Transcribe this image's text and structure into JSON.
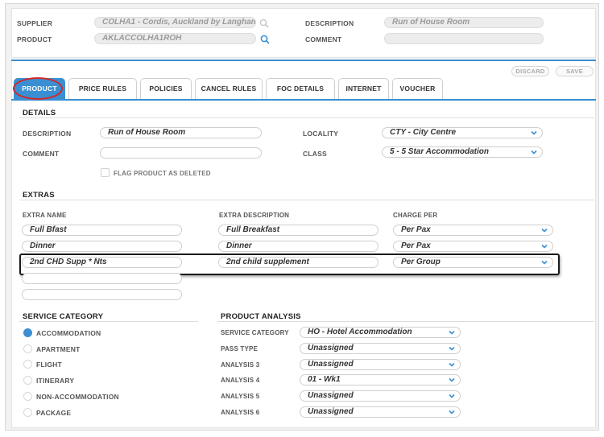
{
  "header": {
    "supplier_label": "SUPPLIER",
    "supplier_value": "COLHA1 - Cordis, Auckland by Langham",
    "product_label": "PRODUCT",
    "product_value": "AKLACCOLHA1ROH",
    "description_label": "DESCRIPTION",
    "description_value": "Run of House Room",
    "comment_label": "COMMENT",
    "comment_value": ""
  },
  "actions": {
    "discard": "DISCARD",
    "save": "SAVE"
  },
  "tabs": [
    {
      "label": "PRODUCT",
      "active": true
    },
    {
      "label": "PRICE RULES",
      "active": false
    },
    {
      "label": "POLICIES",
      "active": false
    },
    {
      "label": "CANCEL RULES",
      "active": false
    },
    {
      "label": "FOC DETAILS",
      "active": false
    },
    {
      "label": "INTERNET",
      "active": false
    },
    {
      "label": "VOUCHER",
      "active": false
    }
  ],
  "details": {
    "title": "DETAILS",
    "description_label": "DESCRIPTION",
    "description_value": "Run of House Room",
    "comment_label": "COMMENT",
    "comment_value": "",
    "flag_label": "FLAG PRODUCT AS DELETED",
    "locality_label": "LOCALITY",
    "locality_value": "CTY - City Centre",
    "class_label": "CLASS",
    "class_value": "5 - 5 Star Accommodation"
  },
  "extras": {
    "title": "EXTRAS",
    "col_name": "EXTRA NAME",
    "col_description": "EXTRA DESCRIPTION",
    "col_charge": "CHARGE PER",
    "rows": [
      {
        "name": "Full Bfast",
        "description": "Full Breakfast",
        "charge": "Per Pax"
      },
      {
        "name": "Dinner",
        "description": "Dinner",
        "charge": "Per Pax"
      },
      {
        "name": "2nd CHD Supp * Nts",
        "description": "2nd child supplement",
        "charge": "Per Group"
      },
      {
        "name": "",
        "description": "",
        "charge": ""
      },
      {
        "name": "",
        "description": "",
        "charge": ""
      }
    ]
  },
  "service_category": {
    "title": "SERVICE CATEGORY",
    "options": [
      {
        "label": "ACCOMMODATION",
        "checked": true
      },
      {
        "label": "APARTMENT",
        "checked": false
      },
      {
        "label": "FLIGHT",
        "checked": false
      },
      {
        "label": "ITINERARY",
        "checked": false
      },
      {
        "label": "NON-ACCOMMODATION",
        "checked": false
      },
      {
        "label": "PACKAGE",
        "checked": false
      }
    ]
  },
  "product_analysis": {
    "title": "PRODUCT ANALYSIS",
    "rows": [
      {
        "label": "SERVICE CATEGORY",
        "value": "HO - Hotel Accommodation"
      },
      {
        "label": "PASS TYPE",
        "value": "Unassigned"
      },
      {
        "label": "ANALYSIS 3",
        "value": "Unassigned"
      },
      {
        "label": "ANALYSIS 4",
        "value": "01 - Wk1"
      },
      {
        "label": "ANALYSIS 5",
        "value": "Unassigned"
      },
      {
        "label": "ANALYSIS 6",
        "value": "Unassigned"
      }
    ]
  },
  "colors": {
    "accent": "#3a8fd3",
    "annotation_red": "#d02828"
  }
}
